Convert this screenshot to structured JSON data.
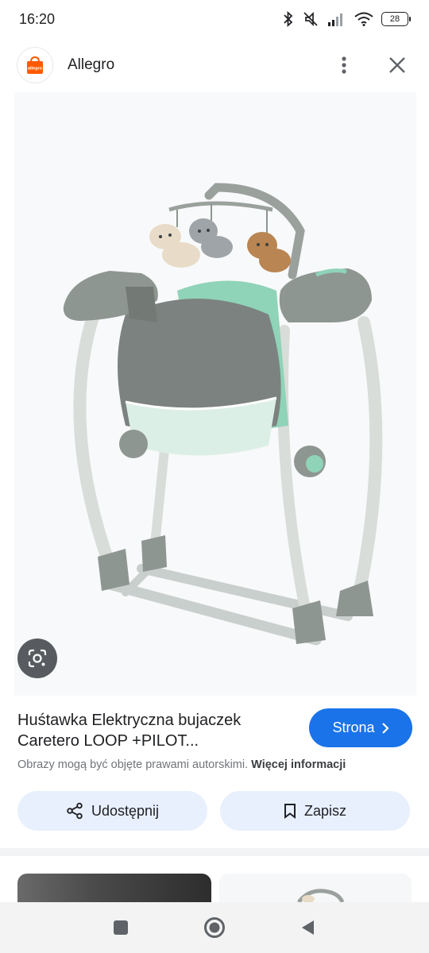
{
  "status_bar": {
    "time": "16:20",
    "battery": "28",
    "icons": [
      "bluetooth-icon",
      "mute-icon",
      "signal-icon",
      "wifi-icon",
      "battery-icon"
    ]
  },
  "header": {
    "app_name": "Allegro",
    "logo_text": "allegro",
    "brand_color": "#ff5a00",
    "icons": [
      "more-vert-icon",
      "close-icon"
    ]
  },
  "result": {
    "title": "Huśtawka Elektryczna bujaczek Caretero LOOP +PILOT...",
    "site_button_label": "Strona",
    "copyright_text": "Obrazy mogą być objęte prawami autorskimi.",
    "more_info_label": "Więcej informacji",
    "share_label": "Udostępnij",
    "save_label": "Zapisz",
    "accent_color": "#1a73e8"
  },
  "navigation": {
    "icons": [
      "recents-icon",
      "home-icon",
      "back-icon"
    ]
  }
}
